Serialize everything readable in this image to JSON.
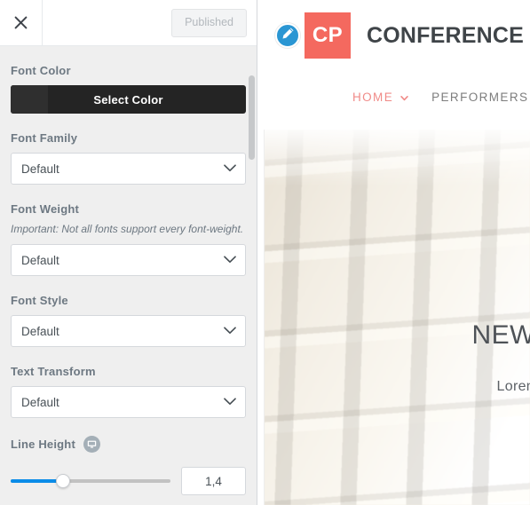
{
  "panel": {
    "header": {
      "close_icon": "close-icon",
      "publish_label": "Published"
    },
    "controls": [
      {
        "label": "Font Color",
        "type": "color",
        "button_label": "Select Color",
        "value_color": "#242424"
      },
      {
        "label": "Font Family",
        "type": "select",
        "value": "Default"
      },
      {
        "label": "Font Weight",
        "type": "select",
        "value": "Default",
        "hint": "Important: Not all fonts support every font-weight."
      },
      {
        "label": "Font Style",
        "type": "select",
        "value": "Default"
      },
      {
        "label": "Text Transform",
        "type": "select",
        "value": "Default"
      },
      {
        "label": "Line Height",
        "type": "slider",
        "value": "1,4",
        "device_icon": "desktop-icon",
        "fill_percent": 33
      }
    ]
  },
  "preview": {
    "edit_icon": "pencil-icon",
    "logo_mark": "CP",
    "brand_name": "CONFERENCE PRO",
    "nav": [
      {
        "label": "HOME",
        "active": true,
        "has_dropdown": true
      },
      {
        "label": "PERFORMERS",
        "active": false,
        "has_dropdown": false
      }
    ],
    "hero": {
      "title": "NEW",
      "subtitle": "Lorem i"
    }
  },
  "colors": {
    "accent_blue": "#0b8ce8",
    "brand_salmon": "#f4695f",
    "nav_active": "#f08b88",
    "panel_bg": "#efefef",
    "label_grey": "#6d7882"
  }
}
